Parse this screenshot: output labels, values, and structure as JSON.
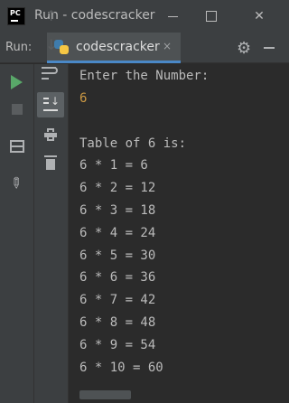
{
  "window": {
    "title": "Run - codescracker",
    "close_glyph": "✕"
  },
  "run_panel": {
    "label": "Run:",
    "tab_label": "codescracker",
    "tab_close": "×",
    "gear_glyph": "⚙"
  },
  "console": {
    "lines": [
      "Enter the Number:",
      "6",
      "",
      "Table of 6 is:",
      "6 * 1 = 6",
      "6 * 2 = 12",
      "6 * 3 = 18",
      "6 * 4 = 24",
      "6 * 5 = 30",
      "6 * 6 = 36",
      "6 * 7 = 42",
      "6 * 8 = 48",
      "6 * 9 = 54",
      "6 * 10 = 60"
    ]
  },
  "icons": {
    "up": "↑",
    "down": "↓",
    "pin": "📌"
  },
  "colors": {
    "background": "#2b2b2b",
    "panel": "#3c3f41",
    "text": "#bbbbbb",
    "user_input": "#cc9944",
    "run_green": "#59a869",
    "tab_underline": "#4a88c7"
  }
}
